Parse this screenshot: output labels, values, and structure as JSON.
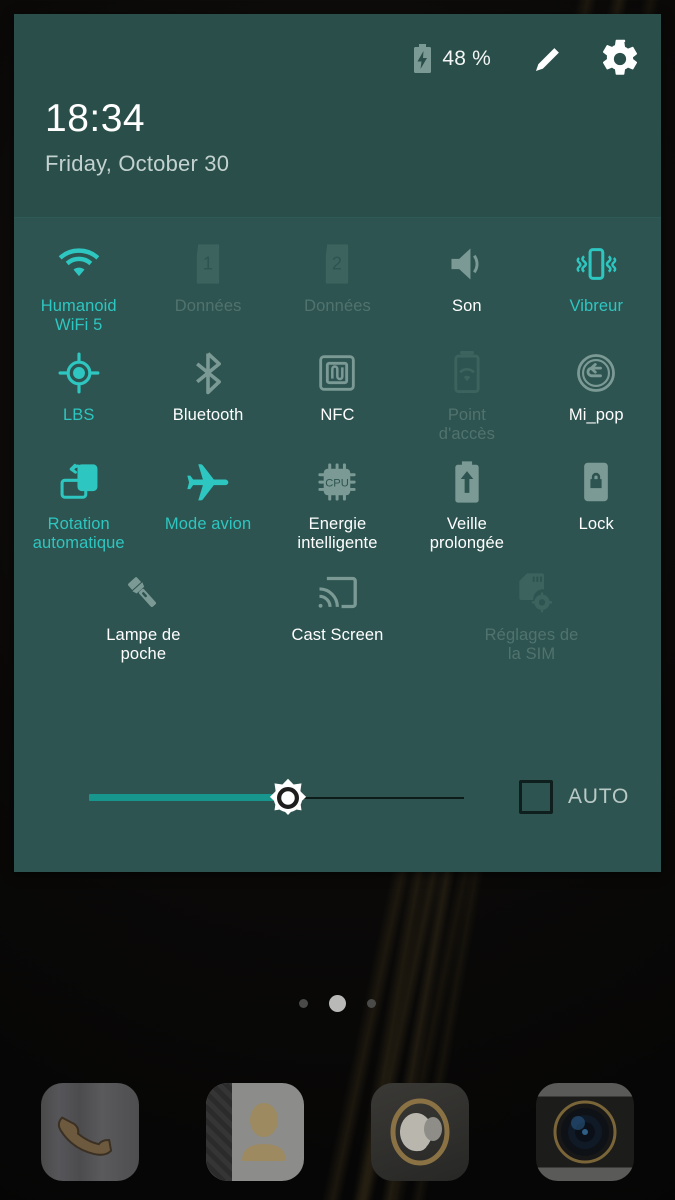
{
  "statusbar": {
    "battery_percent": "48 %",
    "battery_icon": "battery-charging-icon",
    "edit_icon": "pencil-edit-icon",
    "settings_icon": "gear-settings-icon"
  },
  "header": {
    "time": "18:34",
    "date": "Friday, October 30"
  },
  "tiles": [
    [
      {
        "label": "Humanoid\nWiFi 5",
        "label_lines": [
          "Humanoid",
          "WiFi 5"
        ],
        "icon": "wifi-icon",
        "state": "on"
      },
      {
        "label": "Données",
        "label_lines": [
          "Données"
        ],
        "icon": "sim-1-data-icon",
        "state": "dim"
      },
      {
        "label": "Données",
        "label_lines": [
          "Données"
        ],
        "icon": "sim-2-data-icon",
        "state": "dim"
      },
      {
        "label": "Son",
        "label_lines": [
          "Son"
        ],
        "icon": "speaker-sound-icon",
        "state": "off"
      },
      {
        "label": "Vibreur",
        "label_lines": [
          "Vibreur"
        ],
        "icon": "vibrate-icon",
        "state": "on"
      }
    ],
    [
      {
        "label": "LBS",
        "label_lines": [
          "LBS"
        ],
        "icon": "location-lbs-icon",
        "state": "on"
      },
      {
        "label": "Bluetooth",
        "label_lines": [
          "Bluetooth"
        ],
        "icon": "bluetooth-icon",
        "state": "off"
      },
      {
        "label": "NFC",
        "label_lines": [
          "NFC"
        ],
        "icon": "nfc-icon",
        "state": "off"
      },
      {
        "label": "Point\nd'accès",
        "label_lines": [
          "Point",
          "d'accès"
        ],
        "icon": "hotspot-icon",
        "state": "dim"
      },
      {
        "label": "Mi_pop",
        "label_lines": [
          "Mi_pop"
        ],
        "icon": "mi-pop-icon",
        "state": "off"
      }
    ],
    [
      {
        "label": "Rotation\nautomatique",
        "label_lines": [
          "Rotation",
          "automatique"
        ],
        "icon": "auto-rotate-icon",
        "state": "on"
      },
      {
        "label": "Mode avion",
        "label_lines": [
          "Mode avion"
        ],
        "icon": "airplane-mode-icon",
        "state": "on"
      },
      {
        "label": "Energie\nintelligente",
        "label_lines": [
          "Energie",
          "intelligente"
        ],
        "icon": "cpu-smart-power-icon",
        "state": "off"
      },
      {
        "label": "Veille\nprolongée",
        "label_lines": [
          "Veille",
          "prolongée"
        ],
        "icon": "extended-standby-icon",
        "state": "off"
      },
      {
        "label": "Lock",
        "label_lines": [
          "Lock"
        ],
        "icon": "lock-icon",
        "state": "off"
      }
    ],
    [
      {
        "label": "Lampe de\npoche",
        "label_lines": [
          "Lampe de",
          "poche"
        ],
        "icon": "flashlight-icon",
        "state": "off"
      },
      {
        "label": "Cast Screen",
        "label_lines": [
          "Cast Screen"
        ],
        "icon": "cast-screen-icon",
        "state": "off"
      },
      {
        "label": "Réglages de\nla SIM",
        "label_lines": [
          "Réglages de",
          "la SIM"
        ],
        "icon": "sim-settings-icon",
        "state": "dim"
      }
    ]
  ],
  "brightness": {
    "value_percent": 53,
    "slider_icon": "brightness-sun-icon",
    "auto_label": "AUTO",
    "auto_checked": false
  },
  "home": {
    "page_dots": {
      "count": 3,
      "active_index": 1
    },
    "dock": [
      {
        "label": "Phone",
        "icon": "phone-handset-icon"
      },
      {
        "label": "Contacts",
        "icon": "contacts-person-icon"
      },
      {
        "label": "Messaging",
        "icon": "messaging-bubbles-icon"
      },
      {
        "label": "Camera",
        "icon": "camera-lens-icon"
      }
    ]
  },
  "colors": {
    "panel_bg": "#2d5450",
    "header_bg": "#2a4e4a",
    "accent_on": "#2ec6c0",
    "label_off": "#ffffff",
    "label_dim": "#51736e",
    "slider_fill": "#17968e"
  }
}
